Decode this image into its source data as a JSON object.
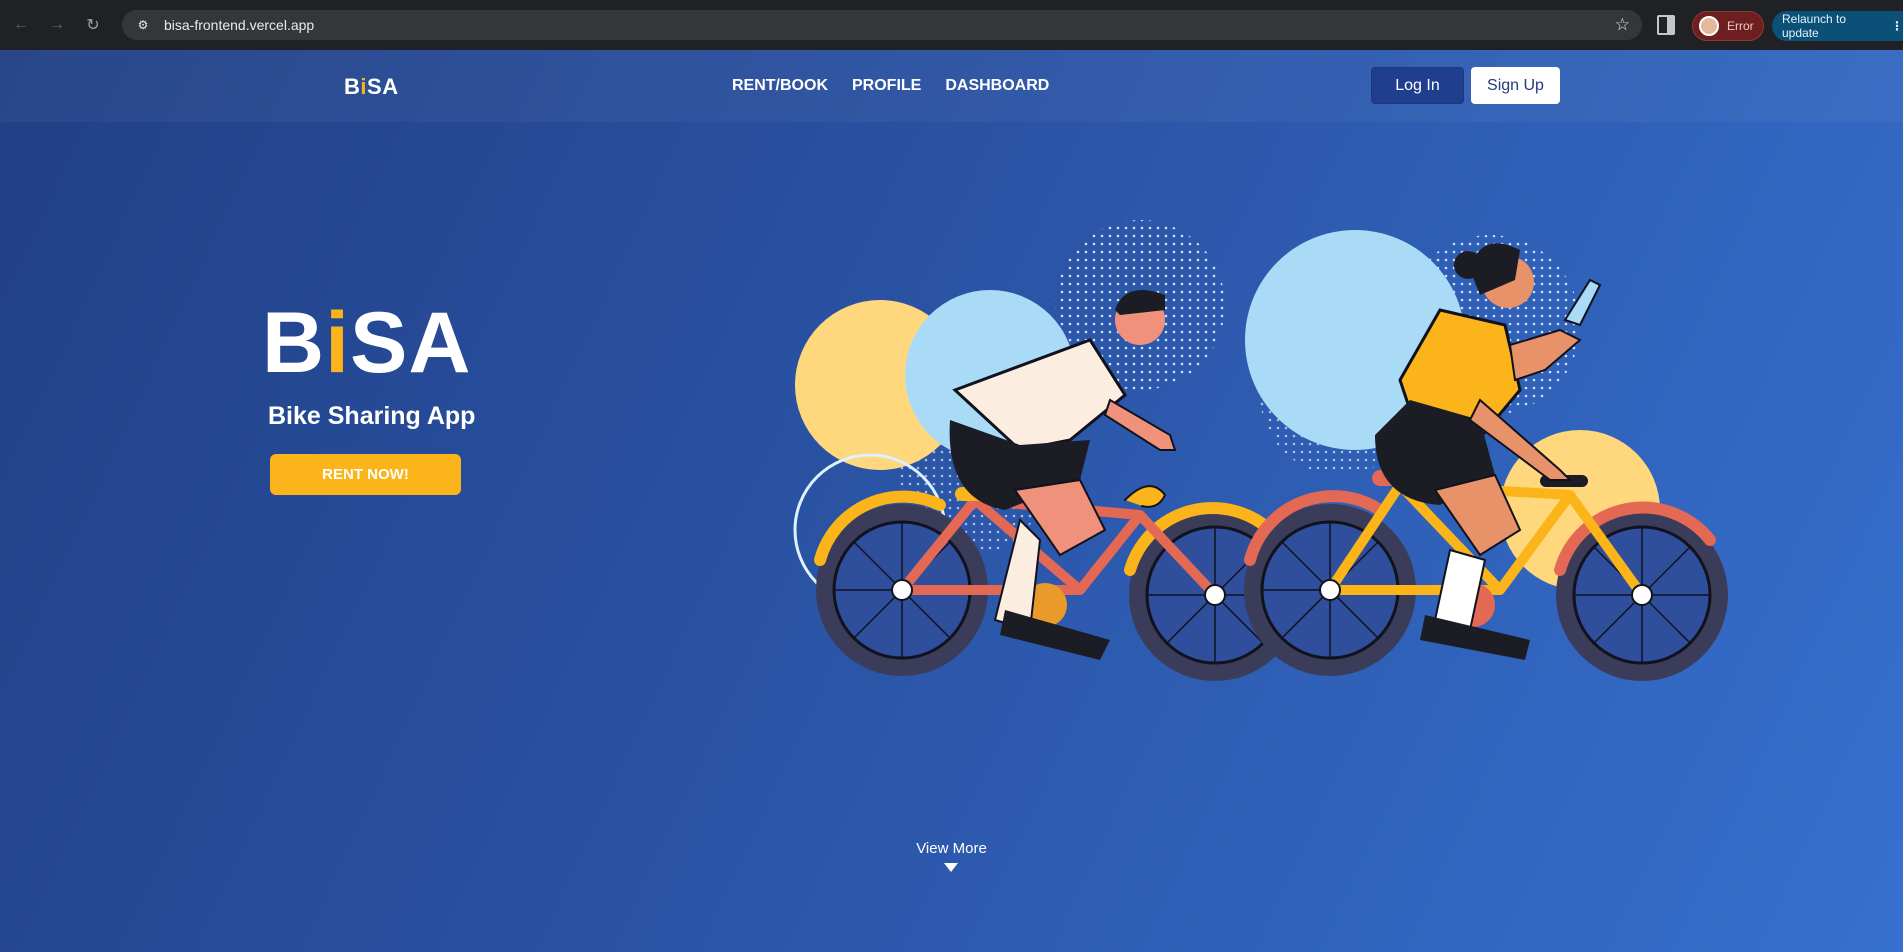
{
  "browser": {
    "url": "bisa-frontend.vercel.app",
    "profile_status": "Error",
    "relaunch_label": "Relaunch to update",
    "menu_dots": "⋮",
    "back_glyph": "←",
    "forward_glyph": "→",
    "reload_glyph": "↻",
    "star_glyph": "☆",
    "site_info_glyph": "⚙"
  },
  "header": {
    "logo": {
      "pre": "B",
      "accent": "i",
      "post": "SA"
    },
    "nav": [
      "RENT/BOOK",
      "PROFILE",
      "DASHBOARD"
    ],
    "login_label": "Log In",
    "signup_label": "Sign Up"
  },
  "hero": {
    "logo": {
      "pre": "B",
      "accent": "i",
      "post": "SA"
    },
    "subtitle": "Bike Sharing App",
    "cta_label": "RENT NOW!"
  },
  "footer": {
    "view_more_label": "View More"
  },
  "colors": {
    "accent": "#fbb419",
    "page_bg": "#2a53a4",
    "login_bg": "#1f3f8e"
  }
}
